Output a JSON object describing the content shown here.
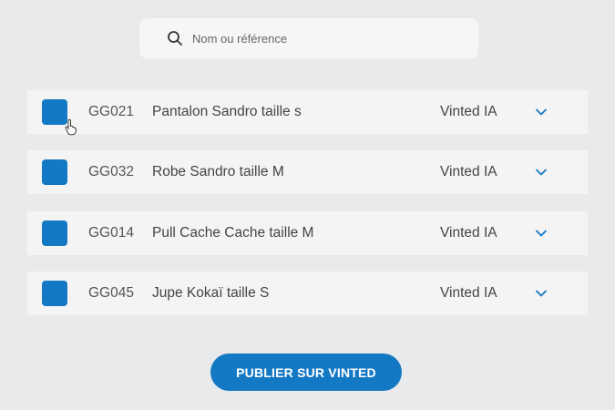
{
  "search": {
    "placeholder": "Nom ou référence"
  },
  "items": [
    {
      "ref": "GG021",
      "title": "Pantalon Sandro taille s",
      "platform": "Vinted IA"
    },
    {
      "ref": "GG032",
      "title": "Robe Sandro taille M",
      "platform": "Vinted IA"
    },
    {
      "ref": "GG014",
      "title": "Pull Cache Cache taille M",
      "platform": "Vinted IA"
    },
    {
      "ref": "GG045",
      "title": "Jupe Kokaï taille S",
      "platform": "Vinted IA"
    }
  ],
  "publish_label": "PUBLIER SUR VINTED",
  "colors": {
    "accent": "#1479c4",
    "background": "#e9eaec",
    "row": "#f4f4f5"
  },
  "icons": {
    "search": "search-icon",
    "expand": "chevron-down-icon",
    "cursor": "hand-pointer-icon"
  }
}
